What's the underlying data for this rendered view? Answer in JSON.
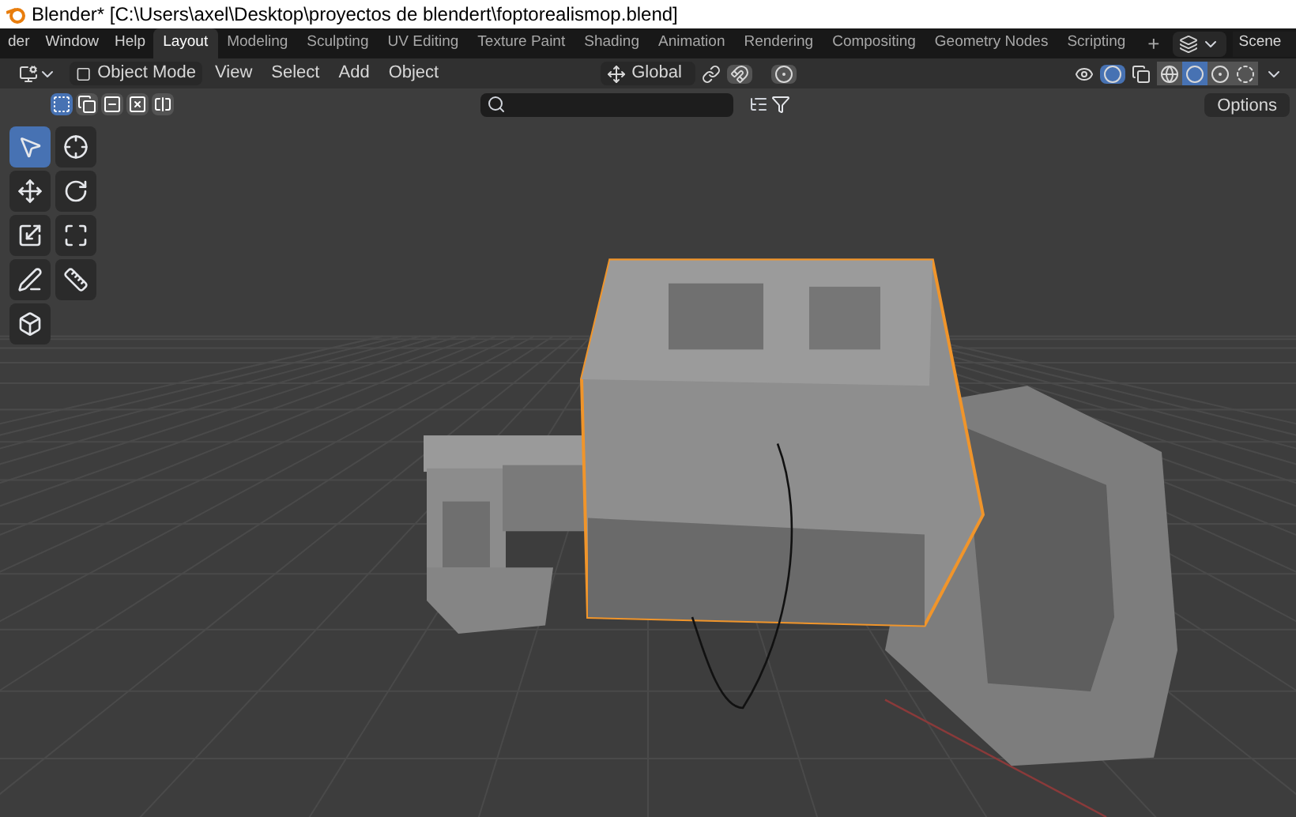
{
  "window": {
    "title": "Blender* [C:\\Users\\axel\\Desktop\\proyectos de blendert\\foptorealismop.blend]"
  },
  "menus": [
    "der",
    "Window",
    "Help"
  ],
  "workspaces": [
    {
      "label": "Layout",
      "selected": true
    },
    {
      "label": "Modeling",
      "selected": false
    },
    {
      "label": "Sculpting",
      "selected": false
    },
    {
      "label": "UV Editing",
      "selected": false
    },
    {
      "label": "Texture Paint",
      "selected": false
    },
    {
      "label": "Shading",
      "selected": false
    },
    {
      "label": "Animation",
      "selected": false
    },
    {
      "label": "Rendering",
      "selected": false
    },
    {
      "label": "Compositing",
      "selected": false
    },
    {
      "label": "Geometry Nodes",
      "selected": false
    },
    {
      "label": "Scripting",
      "selected": false
    }
  ],
  "add_workspace": "+",
  "scene": {
    "value": "Scene"
  },
  "header": {
    "mode": "Object Mode",
    "menus": [
      "View",
      "Select",
      "Add",
      "Object"
    ],
    "orientation": "Global"
  },
  "shading_modes": [
    {
      "kind": "wire",
      "selected": false
    },
    {
      "kind": "solid",
      "selected": true
    },
    {
      "kind": "material",
      "selected": false
    },
    {
      "kind": "rendered",
      "selected": false
    }
  ],
  "select_modes": [
    {
      "kind": "box",
      "selected": true
    },
    {
      "kind": "extend",
      "selected": false
    },
    {
      "kind": "subtract",
      "selected": false
    },
    {
      "kind": "invert",
      "selected": false
    },
    {
      "kind": "intersect",
      "selected": false
    }
  ],
  "options": "Options",
  "tools": [
    {
      "kind": "select",
      "selected": true
    },
    {
      "kind": "cursor",
      "selected": false
    },
    {
      "kind": "move",
      "selected": false
    },
    {
      "kind": "rotate",
      "selected": false
    },
    {
      "kind": "scale",
      "selected": false
    },
    {
      "kind": "transform",
      "selected": false
    },
    {
      "kind": "annotate",
      "selected": false
    },
    {
      "kind": "measure",
      "selected": false
    },
    {
      "kind": "add-cube",
      "selected": false
    }
  ]
}
